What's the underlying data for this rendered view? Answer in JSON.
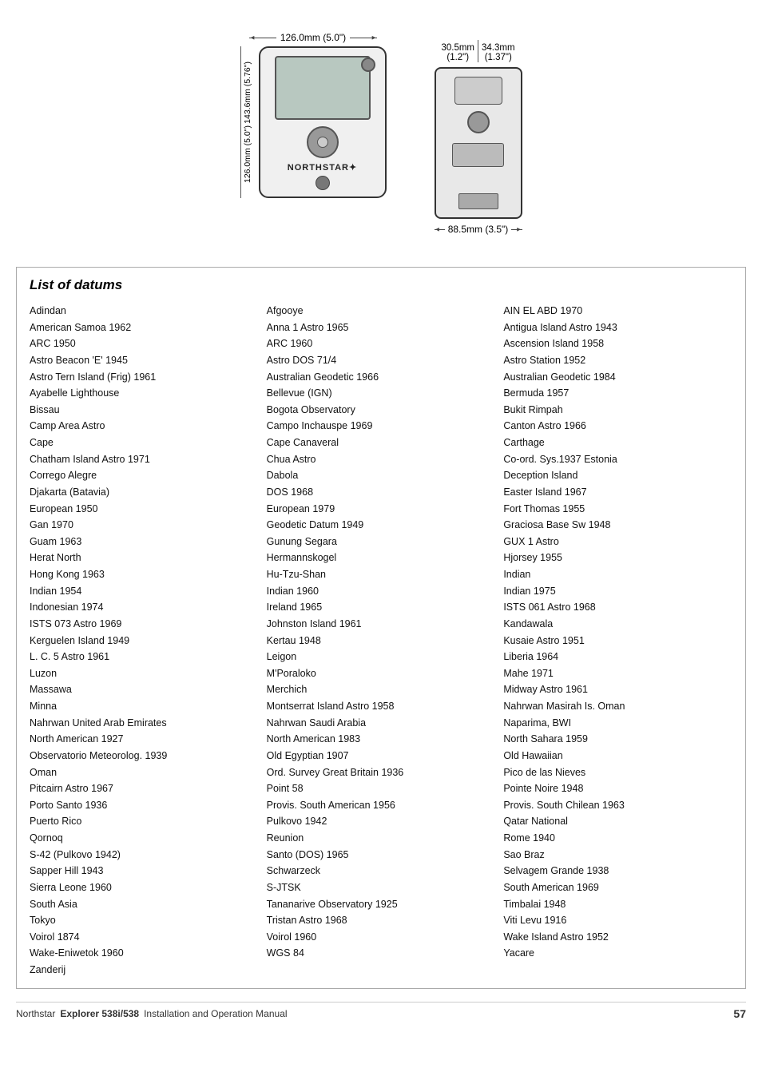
{
  "diagram": {
    "dim_width_mm": "126.0mm (5.0\")",
    "dim_height_outer_mm": "143.6mm (5.76\")",
    "dim_height_inner_mm": "126.0mm (5.0\")",
    "dim_side_width1": "30.5mm",
    "dim_side_width2": "34.3mm",
    "dim_side_width1_in": "(1.2\")",
    "dim_side_width2_in": "(1.37\")",
    "dim_bottom_mm": "88.5mm (3.5\")",
    "brand": "NORTHSTAR✦"
  },
  "datums": {
    "title": "List of datums",
    "col1": [
      "Adindan",
      "American Samoa 1962",
      "ARC 1950",
      "Astro Beacon 'E' 1945",
      "Astro Tern Island (Frig) 1961",
      "Ayabelle Lighthouse",
      "Bissau",
      "Camp Area Astro",
      "Cape",
      "Chatham Island Astro 1971",
      "Corrego Alegre",
      "Djakarta (Batavia)",
      "European 1950",
      "Gan 1970",
      "Guam 1963",
      "Herat North",
      "Hong Kong 1963",
      "Indian 1954",
      "Indonesian 1974",
      "ISTS 073 Astro 1969",
      "Kerguelen Island 1949",
      "L. C. 5 Astro 1961",
      "Luzon",
      "Massawa",
      "Minna",
      "Nahrwan United Arab Emirates",
      "North American 1927",
      "Observatorio Meteorolog. 1939",
      "Oman",
      "Pitcairn Astro 1967",
      "Porto Santo 1936",
      "Puerto Rico",
      "Qornoq",
      "S-42 (Pulkovo 1942)",
      "Sapper Hill 1943",
      "Sierra Leone 1960",
      "South Asia",
      "Tokyo",
      "Voirol 1874",
      "Wake-Eniwetok 1960",
      "Zanderij"
    ],
    "col2": [
      "Afgooye",
      "Anna 1 Astro 1965",
      "ARC 1960",
      "Astro DOS 71/4",
      "Australian Geodetic 1966",
      "Bellevue (IGN)",
      "Bogota Observatory",
      "Campo Inchauspe 1969",
      "Cape Canaveral",
      "Chua Astro",
      "Dabola",
      "DOS 1968",
      "European 1979",
      "Geodetic Datum 1949",
      "Gunung Segara",
      "Hermannskogel",
      "Hu-Tzu-Shan",
      "Indian 1960",
      "Ireland 1965",
      "Johnston Island 1961",
      "Kertau 1948",
      "Leigon",
      "M'Poraloko",
      "Merchich",
      "Montserrat Island Astro 1958",
      "Nahrwan Saudi Arabia",
      "North American 1983",
      "Old Egyptian 1907",
      "Ord. Survey Great Britain 1936",
      "Point 58",
      "Provis. South American 1956",
      "Pulkovo 1942",
      "Reunion",
      "Santo (DOS) 1965",
      "Schwarzeck",
      "S-JTSK",
      "Tananarive Observatory 1925",
      "Tristan Astro 1968",
      "Voirol 1960",
      "WGS 84"
    ],
    "col3": [
      "AIN EL ABD 1970",
      "Antigua Island Astro 1943",
      "Ascension Island 1958",
      "Astro Station 1952",
      "Australian Geodetic 1984",
      "Bermuda 1957",
      "Bukit Rimpah",
      "Canton Astro 1966",
      "Carthage",
      "Co-ord. Sys.1937 Estonia",
      "Deception Island",
      "Easter Island 1967",
      "Fort Thomas 1955",
      "Graciosa Base Sw 1948",
      "GUX 1 Astro",
      "Hjorsey 1955",
      "Indian",
      "Indian 1975",
      "ISTS 061 Astro 1968",
      "Kandawala",
      "Kusaie Astro 1951",
      "Liberia 1964",
      "Mahe 1971",
      "Midway Astro 1961",
      "Nahrwan Masirah Is. Oman",
      "Naparima, BWI",
      "North Sahara 1959",
      "Old Hawaiian",
      "Pico de las Nieves",
      "Pointe Noire 1948",
      "Provis. South Chilean 1963",
      "Qatar National",
      "Rome 1940",
      "Sao Braz",
      "Selvagem Grande 1938",
      "South American 1969",
      "Timbalai 1948",
      "Viti Levu 1916",
      "Wake Island Astro 1952",
      "Yacare"
    ]
  },
  "footer": {
    "brand": "Northstar",
    "product": "Explorer 538i/538",
    "subtitle": "Installation and Operation Manual",
    "page": "57"
  }
}
